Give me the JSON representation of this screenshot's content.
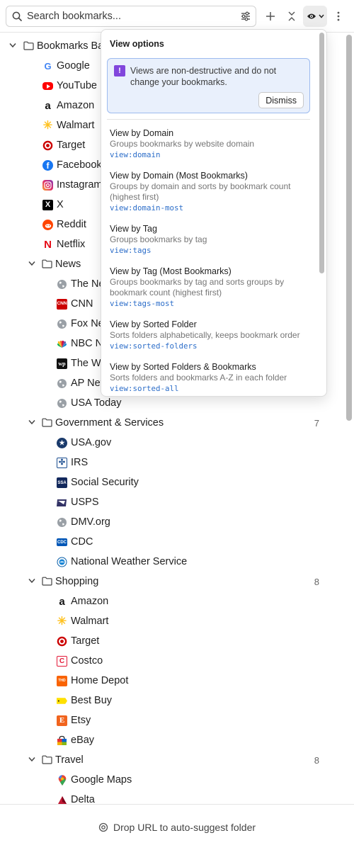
{
  "toolbar": {
    "search_placeholder": "Search bookmarks...",
    "icons": [
      "search-icon",
      "filter-icon",
      "plus-icon",
      "collapse-icon",
      "eye-icon",
      "chevron-down-icon",
      "more-vertical-icon"
    ]
  },
  "tree": {
    "root": {
      "label": "Bookmarks Ba"
    },
    "root_items": [
      {
        "label": "Google",
        "icon": "google-icon"
      },
      {
        "label": "YouTube",
        "icon": "youtube-icon"
      },
      {
        "label": "Amazon",
        "icon": "amazon-icon"
      },
      {
        "label": "Walmart",
        "icon": "walmart-icon"
      },
      {
        "label": "Target",
        "icon": "target-icon"
      },
      {
        "label": "Facebook",
        "icon": "facebook-icon"
      },
      {
        "label": "Instagram",
        "icon": "instagram-icon"
      },
      {
        "label": "X",
        "icon": "x-icon"
      },
      {
        "label": "Reddit",
        "icon": "reddit-icon"
      },
      {
        "label": "Netflix",
        "icon": "netflix-icon"
      }
    ],
    "folders": [
      {
        "label": "News",
        "count": "",
        "items": [
          {
            "label": "The Ne",
            "icon": "globe-icon"
          },
          {
            "label": "CNN",
            "icon": "cnn-icon"
          },
          {
            "label": "Fox Ne",
            "icon": "globe-icon"
          },
          {
            "label": "NBC N",
            "icon": "nbc-icon"
          },
          {
            "label": "The W",
            "icon": "wapo-icon"
          },
          {
            "label": "AP Nev",
            "icon": "globe-icon"
          },
          {
            "label": "USA Today",
            "icon": "globe-icon"
          }
        ]
      },
      {
        "label": "Government & Services",
        "count": "7",
        "items": [
          {
            "label": "USA.gov",
            "icon": "usagov-icon"
          },
          {
            "label": "IRS",
            "icon": "irs-icon"
          },
          {
            "label": "Social Security",
            "icon": "ssa-icon"
          },
          {
            "label": "USPS",
            "icon": "usps-icon"
          },
          {
            "label": "DMV.org",
            "icon": "globe-icon"
          },
          {
            "label": "CDC",
            "icon": "cdc-icon"
          },
          {
            "label": "National Weather Service",
            "icon": "nws-icon"
          }
        ]
      },
      {
        "label": "Shopping",
        "count": "8",
        "items": [
          {
            "label": "Amazon",
            "icon": "amazon-icon"
          },
          {
            "label": "Walmart",
            "icon": "walmart-icon"
          },
          {
            "label": "Target",
            "icon": "target-icon"
          },
          {
            "label": "Costco",
            "icon": "costco-icon"
          },
          {
            "label": "Home Depot",
            "icon": "homedepot-icon"
          },
          {
            "label": "Best Buy",
            "icon": "bestbuy-icon"
          },
          {
            "label": "Etsy",
            "icon": "etsy-icon"
          },
          {
            "label": "eBay",
            "icon": "ebay-icon"
          }
        ]
      },
      {
        "label": "Travel",
        "count": "8",
        "items": [
          {
            "label": "Google Maps",
            "icon": "googlemaps-icon"
          },
          {
            "label": "Delta",
            "icon": "delta-icon"
          }
        ]
      }
    ]
  },
  "popover": {
    "title": "View options",
    "info_text": "Views are non-destructive and do not change your bookmarks.",
    "info_badge": "!",
    "dismiss_label": "Dismiss",
    "options": [
      {
        "name": "View by Domain",
        "desc": "Groups bookmarks by website domain",
        "code": "view:domain"
      },
      {
        "name": "View by Domain (Most Bookmarks)",
        "desc": "Groups by domain and sorts by bookmark count (highest first)",
        "code": "view:domain-most"
      },
      {
        "name": "View by Tag",
        "desc": "Groups bookmarks by tag",
        "code": "view:tags"
      },
      {
        "name": "View by Tag (Most Bookmarks)",
        "desc": "Groups bookmarks by tag and sorts groups by bookmark count (highest first)",
        "code": "view:tags-most"
      },
      {
        "name": "View by Sorted Folder",
        "desc": "Sorts folders alphabetically, keeps bookmark order",
        "code": "view:sorted-folders"
      },
      {
        "name": "View by Sorted Folders & Bookmarks",
        "desc": "Sorts folders and bookmarks A-Z in each folder",
        "code": "view:sorted-all"
      }
    ]
  },
  "footer": {
    "text": "Drop URL to auto-suggest folder",
    "icon": "target-crosshair-icon"
  }
}
